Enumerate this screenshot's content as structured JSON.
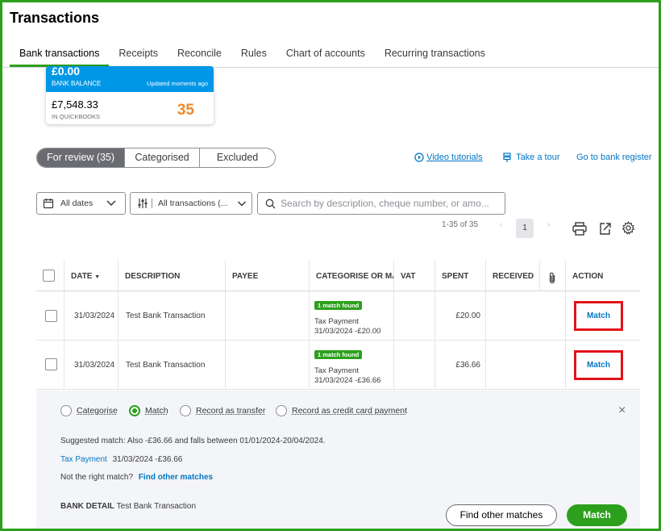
{
  "page": {
    "title": "Transactions"
  },
  "tabs": [
    "Bank transactions",
    "Receipts",
    "Reconcile",
    "Rules",
    "Chart of accounts",
    "Recurring transactions"
  ],
  "card": {
    "bank_amount": "£0.00",
    "bank_label": "BANK BALANCE",
    "updated": "Updated moments ago",
    "qb_amount": "£7,548.33",
    "qb_label": "IN QUICKBOOKS",
    "count": "35"
  },
  "segments": [
    "For review (35)",
    "Categorised",
    "Excluded"
  ],
  "links": {
    "video": "Video tutorials",
    "tour": "Take a tour",
    "register": "Go to bank register"
  },
  "filters": {
    "dates": "All dates",
    "transactions": "All transactions (...",
    "search_placeholder": "Search by description, cheque number, or amo..."
  },
  "pager": {
    "range": "1-35 of 35",
    "page": "1"
  },
  "table": {
    "headers": [
      "DATE",
      "DESCRIPTION",
      "PAYEE",
      "CATEGORISE OR MATCH",
      "VAT",
      "SPENT",
      "RECEIVED",
      "ACTION"
    ],
    "rows": [
      {
        "date": "31/03/2024",
        "description": "Test Bank Transaction",
        "badge": "1 match found",
        "match_line1": "Tax Payment",
        "match_line2": "31/03/2024 -£20.00",
        "spent": "£20.00",
        "action": "Match"
      },
      {
        "date": "31/03/2024",
        "description": "Test Bank Transaction",
        "badge": "1 match found",
        "match_line1": "Tax Payment",
        "match_line2": "31/03/2024 -£36.66",
        "spent": "£36.66",
        "action": "Match"
      }
    ]
  },
  "panel": {
    "options": [
      "Categorise",
      "Match",
      "Record as transfer",
      "Record as credit card payment"
    ],
    "close": "×",
    "suggested": "Suggested match: Also -£36.66 and falls between 01/01/2024-20/04/2024.",
    "tax_link": "Tax Payment",
    "tax_detail": "31/03/2024 -£36.66",
    "not_right": "Not the right match?",
    "find_link": "Find other matches",
    "bank_detail_label": "BANK DETAIL",
    "bank_detail_value": "Test Bank Transaction",
    "btn_find": "Find other matches",
    "btn_match": "Match"
  },
  "colors": {
    "brand_green": "#2ca01c",
    "blue": "#0097e6",
    "link": "#0077c5",
    "highlight_red": "#e2131b",
    "count_orange": "#f0892b"
  }
}
